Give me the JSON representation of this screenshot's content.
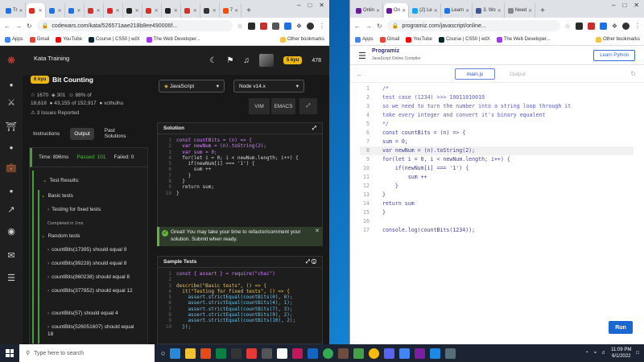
{
  "left_browser": {
    "tabs": [
      {
        "label": "Tr",
        "color": "#1a73e8"
      },
      {
        "label": "",
        "color": "#d93025"
      },
      {
        "label": "",
        "color": "#1a73e8"
      },
      {
        "label": "",
        "color": "#1a73e8"
      },
      {
        "label": "",
        "color": "#d93025"
      },
      {
        "label": "",
        "color": "#e02222"
      },
      {
        "label": "",
        "color": "#222222"
      },
      {
        "label": "",
        "color": "#d93025"
      },
      {
        "label": "",
        "color": "#222222"
      },
      {
        "label": "",
        "color": "#d93025"
      },
      {
        "label": "",
        "color": "#333333"
      },
      {
        "label": "7",
        "color": "#ff4a00"
      }
    ],
    "url": "codewars.com/kata/526571aae218b8ee490006f...",
    "bookmarks": [
      "Apps",
      "Gmail",
      "YouTube",
      "Course | CS50 | edX",
      "The Web Developer..."
    ],
    "other_bookmarks": "Other bookmarks"
  },
  "codewars": {
    "section_title": "Kata Training",
    "honor": "478",
    "rank_badge": "5 kyu",
    "kyu": "6 kyu",
    "kata_name": "Bit Counting",
    "stats": {
      "stars": "1670",
      "votes": "301",
      "satisfaction": "88% of",
      "completed": "18,618",
      "warriors": "43,155 of 152,917",
      "author": "xcthulhu"
    },
    "issues": "3 Issues Reported",
    "language": "JavaScript",
    "version": "Node v14.x",
    "modes": [
      "VIM",
      "EMACS"
    ],
    "out_tabs": [
      "Instructions",
      "Output",
      "Past Solutions"
    ],
    "results": {
      "time": "Time: 896ms",
      "passed": "Passed: 101",
      "failed": "Failed: 0",
      "test_results": "Test Results:",
      "basic_tests": "Basic tests",
      "fixed_tests": "Testing for fixed tests",
      "completed": "Completed in 1ms",
      "random_tests": "Random tests",
      "cases": [
        "countBits(17395) should equal 9",
        "countBits(99228) should equal 8",
        "countBits(860238) should equal 8",
        "countBits(377852) should equal 12",
        "countBits(57) should equal 4",
        "countBits(526051607) should equal 18"
      ]
    },
    "solution_title": "Solution",
    "solution_lines": [
      "const countBits = (n) => {",
      "  var newNum = (n).toString(2);",
      "  var sum = 0;",
      "  for(let i = 0; i < newNum.length; i++) {",
      "    if(newNum[i] === '1') {",
      "      sum ++",
      "    }",
      "  }",
      "  return sum;",
      "}"
    ],
    "success_message": "Great! You may take your time to refactor/comment your solution. Submit when ready.",
    "sample_tests_title": "Sample Tests",
    "sample_lines": [
      "const { assert } = require(\"chai\")",
      "",
      "describe(\"Basic tests\", () => {",
      "  it(\"Testing for fixed tests\", () => {",
      "    assert.strictEqual(countBits(0), 0);",
      "    assert.strictEqual(countBits(4), 1);",
      "    assert.strictEqual(countBits(7), 3);",
      "    assert.strictEqual(countBits(9), 2);",
      "    assert.strictEqual(countBits(10), 2);",
      "  });"
    ]
  },
  "right_browser": {
    "tabs": [
      {
        "label": "Onlin",
        "color": "#6a1b9a"
      },
      {
        "label": "On",
        "color": "#6a1b9a"
      },
      {
        "label": "(2) Le",
        "color": "#1da1f2"
      },
      {
        "label": "Learn",
        "color": "#1a73e8"
      },
      {
        "label": "3. Wo",
        "color": "#3b5998"
      },
      {
        "label": "Need",
        "color": "#888888"
      }
    ],
    "url": "programiz.com/javascript/online...",
    "bookmarks": [
      "Apps",
      "Gmail",
      "YouTube",
      "Course | CS50 | edX",
      "The Web Developer..."
    ],
    "other_bookmarks": "Other bookmarks"
  },
  "programiz": {
    "logo": "Programiz",
    "subtitle": "JavaScript Online Compiler",
    "learn_button": "Learn Python",
    "file_tab": "main.js",
    "output_tab": "Output",
    "run_label": "Run",
    "code_lines": [
      "/*",
      "test case (1234) >>> 10011010010",
      "so we need to turn the number into a string loop through it",
      "take every integer and convert it's binary equalent",
      "*/",
      "const countBits = (n) => {",
      "sum = 0;",
      "var newNum = (n).toString(2);",
      "for(let i = 0, i < newNum.length; i++) {",
      "    if(newNum[i] === '1') {",
      "        sum ++",
      "    }",
      "}",
      "return sum",
      "}",
      "",
      "console.log(countBits(1234));"
    ]
  },
  "taskbar": {
    "search_placeholder": "Type here to search",
    "time": "11:09 PM",
    "date": "6/1/2022"
  }
}
